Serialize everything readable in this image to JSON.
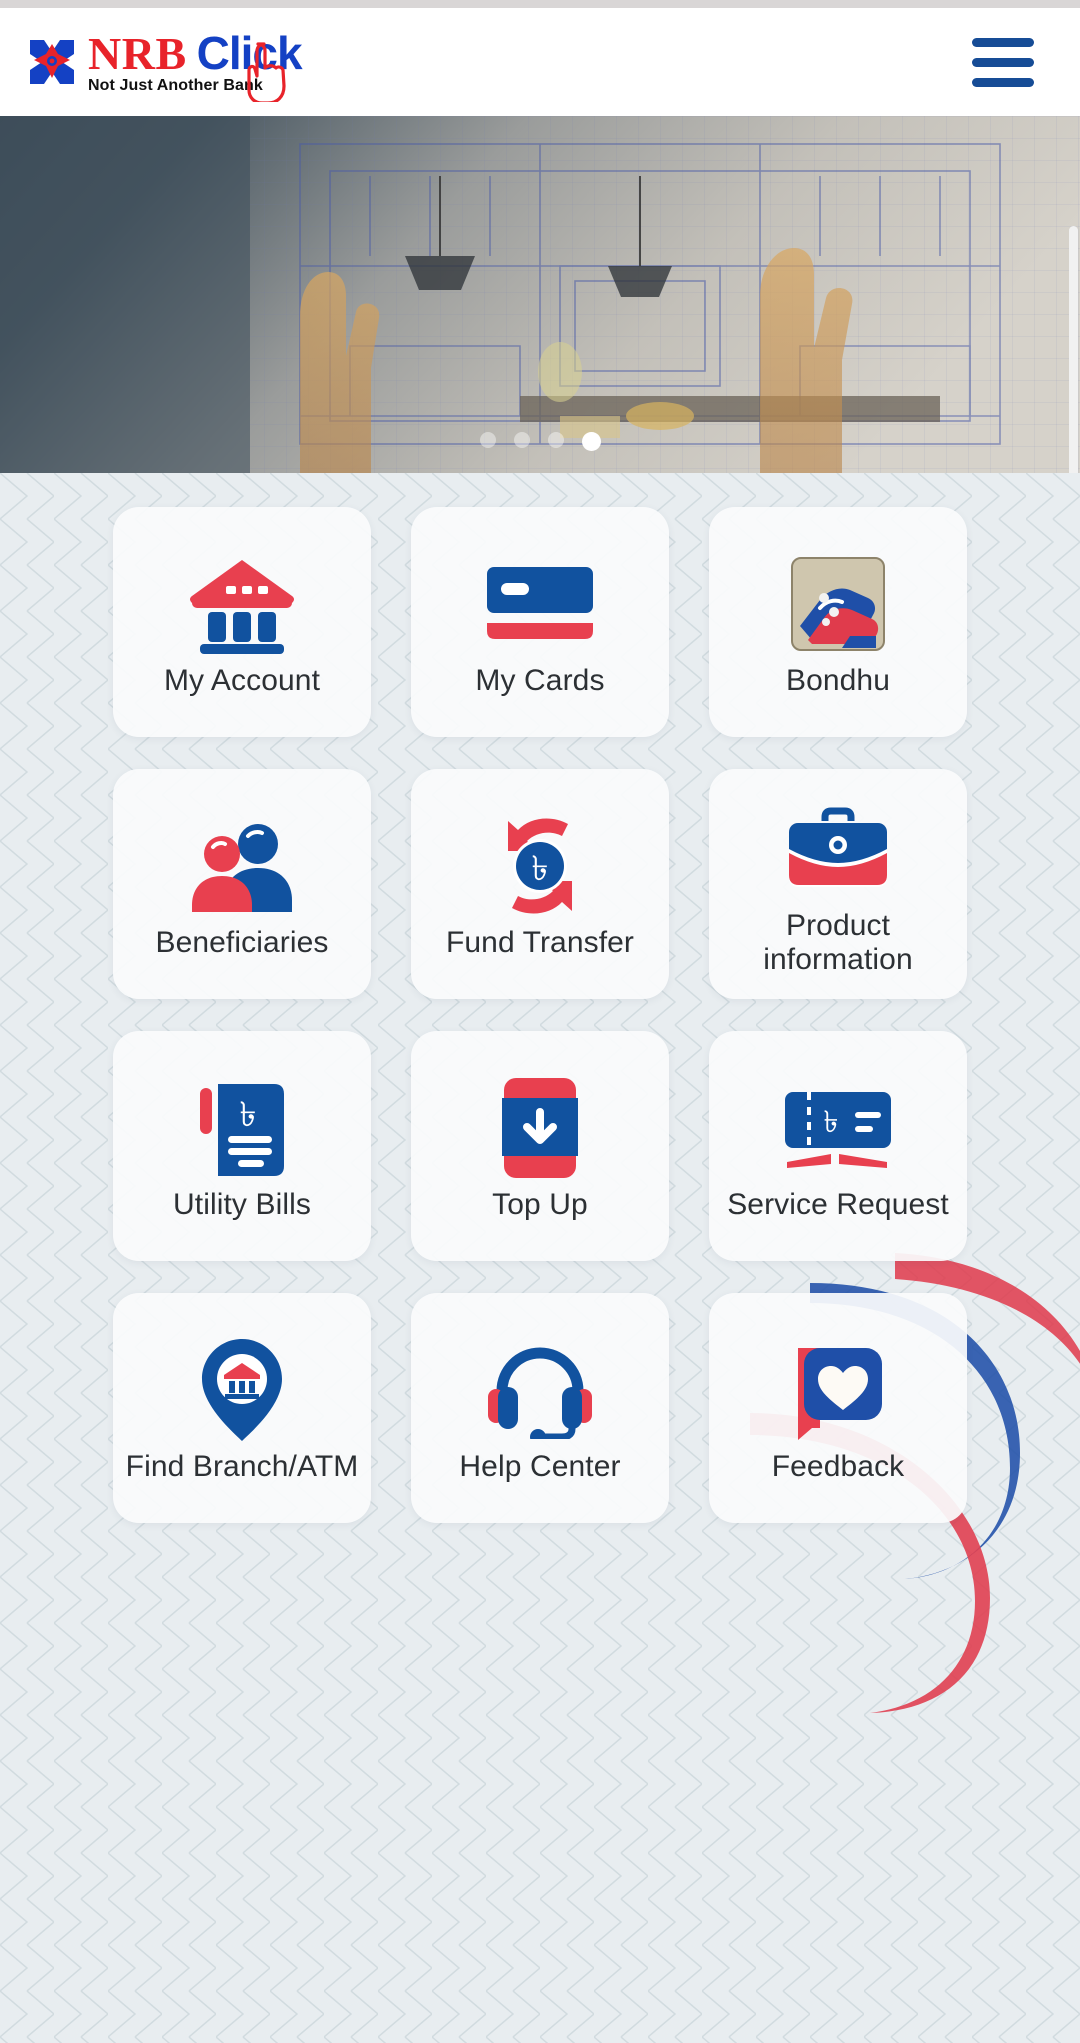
{
  "app": {
    "brand_name": "NRB",
    "brand_name_2": "Click",
    "tagline": "Not Just Another Bank",
    "menu_icon": "hamburger-menu-icon",
    "colors": {
      "brand_red": "#e8232a",
      "brand_blue": "#1441c4",
      "icon_blue": "#11529f",
      "icon_red": "#e8404f",
      "page_background": "#e7ecef",
      "tile_background": "#fafbfc",
      "label_text": "#2c3034"
    }
  },
  "header": {
    "menu_button_label": "Menu"
  },
  "carousel": {
    "slide_count": 4,
    "active_slide": 4,
    "alt": "kitchen interior blueprint with pointing hands"
  },
  "grid": {
    "tiles": [
      {
        "label": "My Account",
        "icon": "bank-building-icon"
      },
      {
        "label": "My Cards",
        "icon": "credit-card-icon"
      },
      {
        "label": "Bondhu",
        "icon": "handshake-icon"
      },
      {
        "label": "Beneficiaries",
        "icon": "two-people-icon"
      },
      {
        "label": "Fund Transfer",
        "icon": "taka-circular-arrows-icon"
      },
      {
        "label": "Product information",
        "icon": "briefcase-icon"
      },
      {
        "label": "Utility Bills",
        "icon": "taka-bill-book-icon"
      },
      {
        "label": "Top Up",
        "icon": "phone-download-icon"
      },
      {
        "label": "Service Request",
        "icon": "cheque-pencil-icon"
      },
      {
        "label": "Find Branch/ATM",
        "icon": "map-pin-bank-icon"
      },
      {
        "label": "Help Center",
        "icon": "headset-icon"
      },
      {
        "label": "Feedback",
        "icon": "chat-heart-icon"
      }
    ]
  }
}
